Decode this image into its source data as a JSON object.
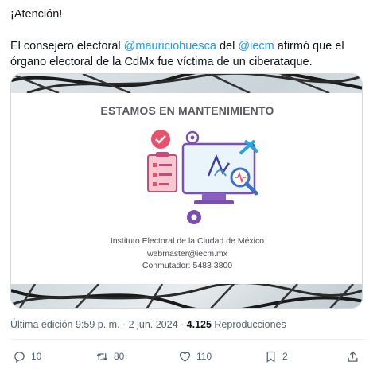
{
  "tweet": {
    "line1": "¡Atención!",
    "text_prefix": "El consejero electoral ",
    "mention1": "@mauriciohuesca",
    "text_mid": " del ",
    "mention2": "@iecm",
    "text_suffix": " afirmó que el órgano electoral de la CdMx fue víctima de un ciberataque."
  },
  "media": {
    "title": "ESTAMOS EN MANTENIMIENTO",
    "org_name": "Instituto Electoral de la Ciudad de México",
    "email": "webmaster@iecm.mx",
    "phone": "Conmutador: 5483 3800"
  },
  "meta": {
    "edited": "Última edición 9:59 p. m.",
    "separator": " · ",
    "date": "2 jun. 2024",
    "views_count": "4.125",
    "views_label": " Reproducciones"
  },
  "actions": {
    "replies": "10",
    "reposts": "80",
    "likes": "110",
    "bookmarks": "2"
  },
  "icons": [
    "reply-icon",
    "repost-icon",
    "like-icon",
    "bookmark-icon",
    "share-icon"
  ],
  "colors": {
    "mention": "#1d9bf0",
    "muted": "#536471",
    "text": "#0f1419"
  }
}
